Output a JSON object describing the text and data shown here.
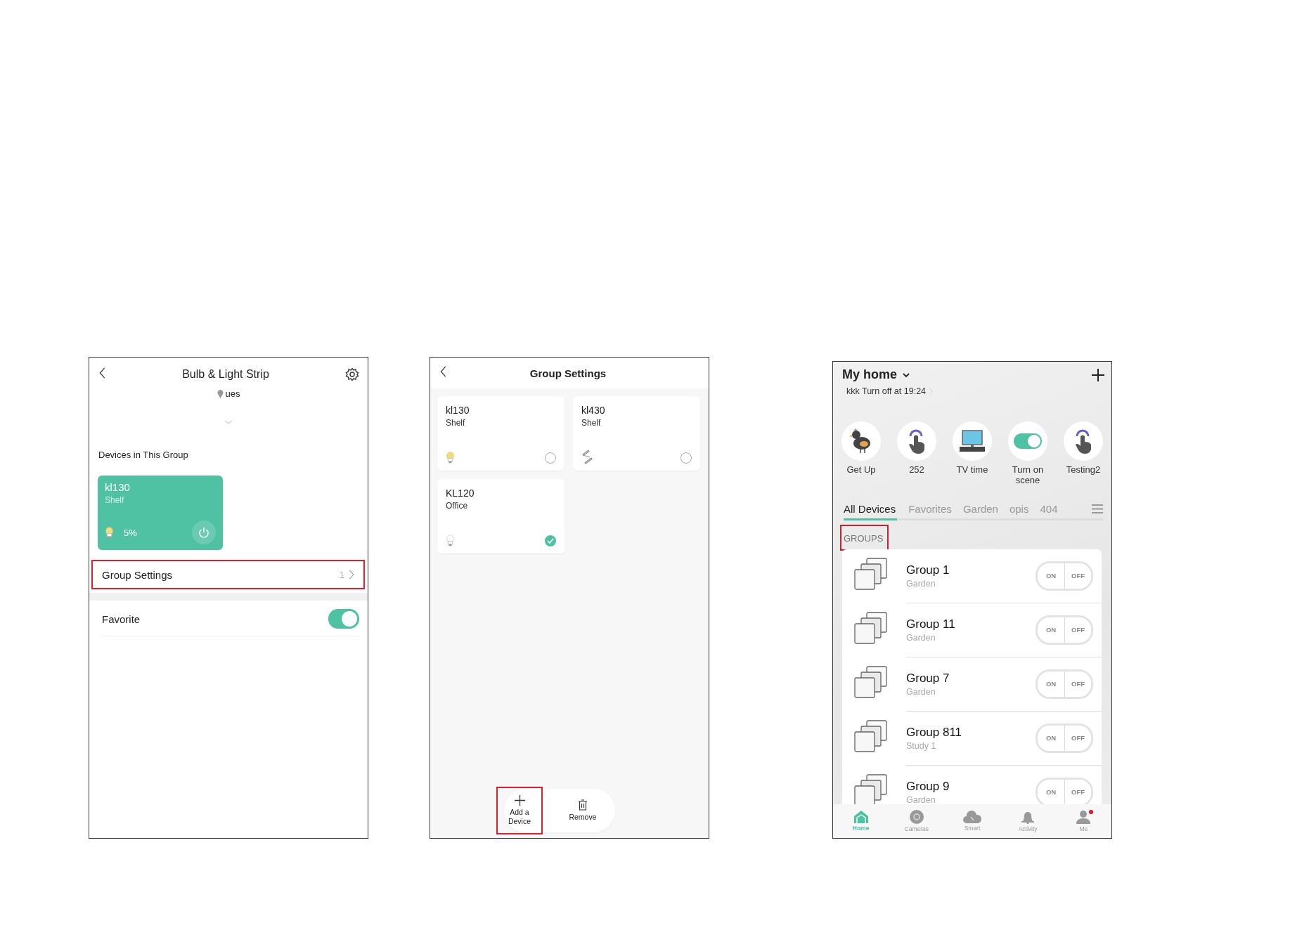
{
  "bulb_strip_screen": {
    "title": "Bulb & Light Strip",
    "location": "ues",
    "section_label": "Devices in This Group",
    "devices": [
      {
        "name": "kl130",
        "room": "Shelf",
        "brightness": "5%",
        "on": true
      }
    ],
    "rows": [
      {
        "kind": "link",
        "label": "Group Settings",
        "value": "1",
        "highlighted": true
      },
      {
        "kind": "toggle",
        "label": "Favorite",
        "on": true
      }
    ]
  },
  "group_settings_screen": {
    "title": "Group Settings",
    "devices": [
      {
        "name": "kl130",
        "room": "Shelf",
        "kind": "bulb",
        "lit": true,
        "selected": false
      },
      {
        "name": "kl430",
        "room": "Shelf",
        "kind": "strip",
        "selected": false
      },
      {
        "name": "KL120",
        "room": "Office",
        "kind": "bulb",
        "lit": false,
        "selected": true
      }
    ],
    "actions": [
      {
        "kind": "add",
        "label": "Add a Device",
        "highlighted": true
      },
      {
        "kind": "remove",
        "label": "Remove",
        "highlighted": false
      }
    ]
  },
  "home_screen": {
    "title": "My home",
    "schedule": "kkk Turn off at 19:24",
    "scenes": [
      {
        "kind": "bird",
        "label": "Get Up"
      },
      {
        "kind": "tap",
        "label": "252"
      },
      {
        "kind": "tv",
        "label": "TV time"
      },
      {
        "kind": "switch",
        "label": "Turn on scene"
      },
      {
        "kind": "tap",
        "label": "Testing2"
      }
    ],
    "tabs": [
      {
        "label": "All Devices",
        "selected": true
      },
      {
        "label": "Favorites",
        "selected": false
      },
      {
        "label": "Garden",
        "selected": false
      },
      {
        "label": "opis",
        "selected": false
      },
      {
        "label": "404",
        "selected": false
      }
    ],
    "section_label": "GROUPS",
    "section_highlighted": true,
    "groups": [
      {
        "name": "Group 1",
        "room": "Garden",
        "on_label": "ON",
        "off_label": "OFF"
      },
      {
        "name": "Group 11",
        "room": "Garden",
        "on_label": "ON",
        "off_label": "OFF"
      },
      {
        "name": "Group 7",
        "room": "Garden",
        "on_label": "ON",
        "off_label": "OFF"
      },
      {
        "name": "Group 811",
        "room": "Study 1",
        "on_label": "ON",
        "off_label": "OFF"
      },
      {
        "name": "Group 9",
        "room": "Garden",
        "on_label": "ON",
        "off_label": "OFF"
      }
    ],
    "nav": [
      {
        "kind": "home",
        "label": "Home",
        "selected": true,
        "badge": false
      },
      {
        "kind": "camera",
        "label": "Cameras",
        "selected": false,
        "badge": false
      },
      {
        "kind": "smart",
        "label": "Smart",
        "selected": false,
        "badge": false
      },
      {
        "kind": "bell",
        "label": "Activity",
        "selected": false,
        "badge": false
      },
      {
        "kind": "person",
        "label": "Me",
        "selected": false,
        "badge": true
      }
    ]
  }
}
